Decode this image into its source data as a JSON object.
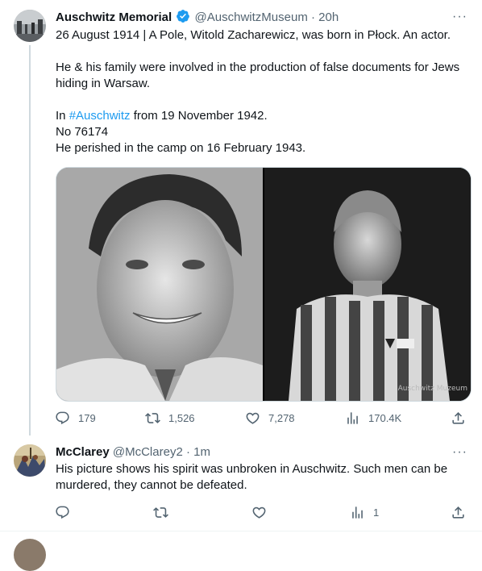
{
  "tweet": {
    "author_name": "Auschwitz Memorial",
    "author_handle": "@AuschwitzMuseum",
    "separator": "·",
    "time": "20h",
    "more": "···",
    "text_line1": "26 August 1914 | A Pole, Witold Zacharewicz, was born in Płock. An actor.",
    "text_line2": "He & his family were involved in the production of false documents for Jews hiding in Warsaw.",
    "text_in": "In ",
    "hashtag": "#Auschwitz",
    "text_from": " from 19 November 1942.",
    "text_no": "No 76174",
    "text_perished": "He perished in the camp on 16 February 1943.",
    "watermark": "Auschwitz Muzeum",
    "stats": {
      "replies": "179",
      "retweets": "1,526",
      "likes": "7,278",
      "views": "170.4K"
    }
  },
  "reply": {
    "author_name": "McClarey",
    "author_handle": "@McClarey2",
    "separator": "·",
    "time": "1m",
    "more": "···",
    "text": "His picture shows his spirit was unbroken in Auschwitz.  Such men can be murdered, they cannot be defeated.",
    "stats": {
      "views": "1"
    }
  },
  "colors": {
    "accent": "#1d9bf0",
    "verified": "#1d9bf0",
    "muted": "#536471",
    "border": "#cfd9de"
  },
  "icons": [
    "verified-badge-icon",
    "reply-icon",
    "retweet-icon",
    "like-icon",
    "views-icon",
    "share-icon",
    "more-icon"
  ]
}
